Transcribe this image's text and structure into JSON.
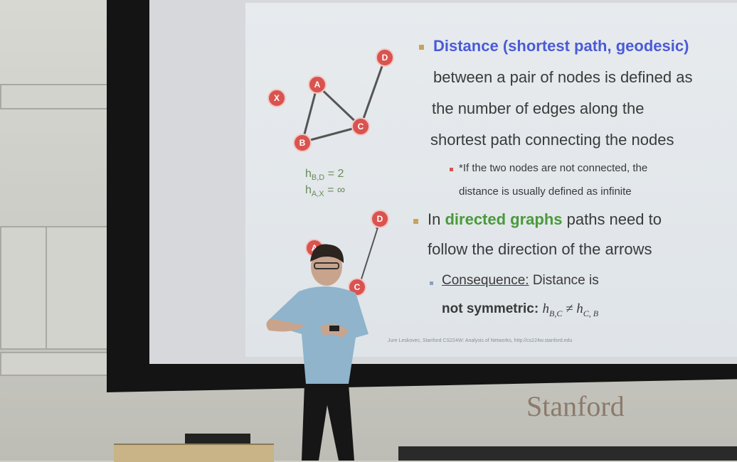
{
  "slide": {
    "bullet1_title": "Distance (shortest path, geodesic)",
    "bullet1_line2": "between a pair of nodes is defined as",
    "bullet1_line3": "the number of edges along the",
    "bullet1_line4": "shortest path connecting the nodes",
    "sub1_line1": "*If the two nodes are not connected, the",
    "sub1_line2": "distance is usually defined as infinite",
    "bullet2_pre": "In ",
    "bullet2_green": "directed graphs",
    "bullet2_post": " paths need to",
    "bullet2_line2": "follow the direction of the arrows",
    "sub2_label": "Consequence:",
    "sub2_rest": " Distance is",
    "sub2_line2_bold": "not symmetric:",
    "sub2_formula": "h",
    "h_bd_label": "h",
    "h_bd_sub": "B,D",
    "h_bd_val": " = 2",
    "h_ax_label": "h",
    "h_ax_sub": "A,X",
    "h_ax_val": " = ∞",
    "footer": "Jure Leskovec, Stanford CS224W: Analysis of Networks, http://cs224w.stanford.edu"
  },
  "graph_top": {
    "nodes": [
      "X",
      "A",
      "B",
      "C",
      "D"
    ]
  },
  "graph_bottom": {
    "nodes": [
      "D",
      "A",
      "C"
    ]
  },
  "logo": {
    "text": "Stanford"
  }
}
